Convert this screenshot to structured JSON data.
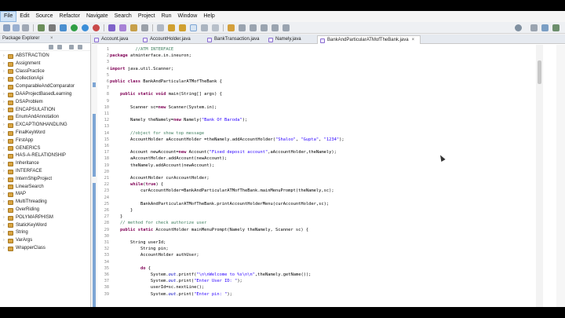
{
  "menu": [
    "File",
    "Edit",
    "Source",
    "Refactor",
    "Navigate",
    "Search",
    "Project",
    "Run",
    "Window",
    "Help"
  ],
  "explorer": {
    "title": "Package Explorer",
    "close": "×",
    "projects": [
      "ABSTRACTION",
      "Assignment",
      "ClassPractice",
      "CollectionApi",
      "ComparableAndComparator",
      "DAAProjectBasedLearning",
      "DSAProblem",
      "ENCAPSULATION",
      "EnumAndAnnotation",
      "EXCAPTIONHANDLING",
      "FinalKeyWord",
      "FirstApp",
      "GENERICS",
      "HAS-A-RELATIONSHIP",
      "Inheritance",
      "INTERFACE",
      "InternShipProject",
      "LinearSearch",
      "MAP",
      "MultiThreading",
      "OverRiding",
      "POLYMARPHISM",
      "StaticKeyWord",
      "String",
      "VarArgs",
      "WrapperClass"
    ]
  },
  "tabs": [
    {
      "label": "Account.java",
      "active": false
    },
    {
      "label": "AccountHolder.java",
      "active": false
    },
    {
      "label": "BankTransaction.java",
      "active": false
    },
    {
      "label": "Namely.java",
      "active": false
    },
    {
      "label": "BankAndParticularATMofTheBank.java",
      "active": true
    }
  ],
  "tab_close": "×",
  "code": {
    "line_numbers": [
      "1",
      "2",
      "3",
      "4",
      "5",
      "6",
      "7",
      "8",
      "9",
      "10",
      "11",
      "12",
      "13",
      "14",
      "15",
      "16",
      "17",
      "18",
      "19",
      "20",
      "21",
      "22",
      "23",
      "24",
      "25",
      "26",
      "27",
      "28",
      "29",
      "30",
      "31",
      "32",
      "33",
      "34",
      "35",
      "36",
      "37",
      "38",
      "39"
    ],
    "lines": [
      [
        {
          "t": "          //ATM INTERFACE",
          "c": "cm"
        }
      ],
      [
        {
          "t": "package ",
          "c": "kw"
        },
        {
          "t": "atminterface.in.ineuron;",
          "c": ""
        }
      ],
      [],
      [
        {
          "t": "import ",
          "c": "kw"
        },
        {
          "t": "java.util.Scanner;",
          "c": ""
        }
      ],
      [],
      [
        {
          "t": "public class ",
          "c": "kw"
        },
        {
          "t": "BankAndParticularATMofTheBank {",
          "c": ""
        }
      ],
      [],
      [
        {
          "t": "    ",
          "c": ""
        },
        {
          "t": "public static void ",
          "c": "kw"
        },
        {
          "t": "main(String[] args) {",
          "c": ""
        }
      ],
      [],
      [
        {
          "t": "        Scanner sc=",
          "c": ""
        },
        {
          "t": "new ",
          "c": "kw"
        },
        {
          "t": "Scanner(System.in);",
          "c": ""
        }
      ],
      [],
      [
        {
          "t": "        Namely theNamely=",
          "c": ""
        },
        {
          "t": "new ",
          "c": "kw"
        },
        {
          "t": "Namely(",
          "c": ""
        },
        {
          "t": "\"Bank Of Baroda\"",
          "c": "st"
        },
        {
          "t": ");",
          "c": ""
        }
      ],
      [],
      [
        {
          "t": "        //object for show top message",
          "c": "cm"
        }
      ],
      [
        {
          "t": "        AccountHolder aAccountHolder =theNamely.addAccountHolder(",
          "c": ""
        },
        {
          "t": "\"Shaloo\"",
          "c": "st"
        },
        {
          "t": ", ",
          "c": ""
        },
        {
          "t": "\"Gupta\"",
          "c": "st"
        },
        {
          "t": ", ",
          "c": ""
        },
        {
          "t": "\"1234\"",
          "c": "st"
        },
        {
          "t": ");",
          "c": ""
        }
      ],
      [],
      [
        {
          "t": "        Account newAccount=",
          "c": ""
        },
        {
          "t": "new ",
          "c": "kw"
        },
        {
          "t": "Account(",
          "c": ""
        },
        {
          "t": "\"Fixed deposit account\"",
          "c": "st"
        },
        {
          "t": ",aAccountHolder,theNamely);",
          "c": ""
        }
      ],
      [
        {
          "t": "        aAccountHolder.addAccount(newAccount);",
          "c": ""
        }
      ],
      [
        {
          "t": "        theNamely.addAccount(newAccount);",
          "c": ""
        }
      ],
      [],
      [
        {
          "t": "        AccountHolder curAccountHolder;",
          "c": ""
        }
      ],
      [
        {
          "t": "        ",
          "c": ""
        },
        {
          "t": "while",
          "c": "kw"
        },
        {
          "t": "(",
          "c": ""
        },
        {
          "t": "true",
          "c": "kw"
        },
        {
          "t": ") {",
          "c": ""
        }
      ],
      [
        {
          "t": "            curAccountHolder=BankAndParticularATMofTheBank.mainMenuPrompt(theNamely,sc);",
          "c": ""
        }
      ],
      [],
      [
        {
          "t": "            BankAndParticularATMofTheBank.printAccountHolderMenu(curAccountHolder,sc);",
          "c": ""
        }
      ],
      [
        {
          "t": "        }",
          "c": ""
        }
      ],
      [
        {
          "t": "    }",
          "c": ""
        }
      ],
      [
        {
          "t": "    // method for check authorize user",
          "c": "cm"
        }
      ],
      [
        {
          "t": "    ",
          "c": ""
        },
        {
          "t": "public static ",
          "c": "kw"
        },
        {
          "t": "AccountHolder mainMenuPrompt(Namely theNamely, Scanner sc) {",
          "c": ""
        }
      ],
      [],
      [
        {
          "t": "        String userId;",
          "c": ""
        }
      ],
      [
        {
          "t": "            String pin;",
          "c": ""
        }
      ],
      [
        {
          "t": "            AccountHolder authUser;",
          "c": ""
        }
      ],
      [],
      [
        {
          "t": "            ",
          "c": ""
        },
        {
          "t": "do ",
          "c": "kw"
        },
        {
          "t": "{",
          "c": ""
        }
      ],
      [
        {
          "t": "                System.",
          "c": ""
        },
        {
          "t": "out",
          "c": "fd"
        },
        {
          "t": ".printf(",
          "c": ""
        },
        {
          "t": "\"\\n\\nWelcome to %s\\n\\n\"",
          "c": "st"
        },
        {
          "t": ",theNamely.getName());",
          "c": ""
        }
      ],
      [
        {
          "t": "                System.",
          "c": ""
        },
        {
          "t": "out",
          "c": "fd"
        },
        {
          "t": ".print(",
          "c": ""
        },
        {
          "t": "\"Enter User ID: \"",
          "c": "st"
        },
        {
          "t": ");",
          "c": ""
        }
      ],
      [
        {
          "t": "                userId=sc.nextLine();",
          "c": ""
        }
      ],
      [
        {
          "t": "                System.",
          "c": ""
        },
        {
          "t": "out",
          "c": "fd"
        },
        {
          "t": ".print(",
          "c": ""
        },
        {
          "t": "\"Enter pin: \"",
          "c": "st"
        },
        {
          "t": ");",
          "c": ""
        }
      ]
    ]
  }
}
